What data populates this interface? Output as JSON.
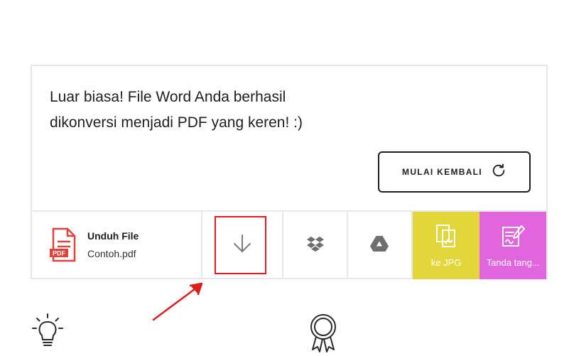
{
  "message": {
    "line1": "Luar biasa! File Word Anda berhasil",
    "line2": "dikonversi menjadi PDF yang keren! :)"
  },
  "restart_button": {
    "label": "MULAI KEMBALI",
    "icon": "refresh-icon"
  },
  "file": {
    "title": "Unduh File",
    "name": "Contoh.pdf",
    "icon": "pdf-file-icon",
    "badge": "PDF"
  },
  "actions": [
    {
      "name": "download",
      "icon": "download-arrow-icon"
    },
    {
      "name": "dropbox",
      "icon": "dropbox-icon"
    },
    {
      "name": "google-drive",
      "icon": "google-drive-icon"
    },
    {
      "name": "to-jpg",
      "label": "ke JPG",
      "icon": "jpg-convert-icon",
      "color": "#e3d63a"
    },
    {
      "name": "sign",
      "label": "Tanda tang...",
      "icon": "sign-icon",
      "color": "#e265e0"
    }
  ],
  "annotation": {
    "color": "#e21b1b"
  }
}
